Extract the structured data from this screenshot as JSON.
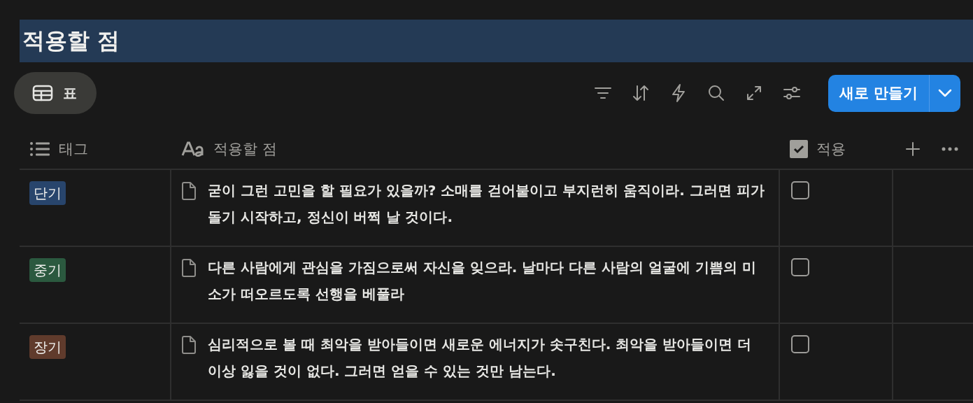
{
  "title": "적용할 점",
  "view_tab": {
    "label": "표",
    "selected": true
  },
  "new_button": {
    "label": "새로 만들기"
  },
  "columns": [
    {
      "kind": "select",
      "label": "태그"
    },
    {
      "kind": "title",
      "label": "적용할 점"
    },
    {
      "kind": "checkbox",
      "label": "적용"
    }
  ],
  "rows": [
    {
      "tag": {
        "label": "단기",
        "color": "#28456c"
      },
      "text": "굳이 그런 고민을 할 필요가 있을까? 소매를 걷어붙이고 부지런히 움직이라. 그러면 피가 돌기 시작하고, 정신이 버쩍 날 것이다.",
      "checked": false
    },
    {
      "tag": {
        "label": "중기",
        "color": "#2b593f"
      },
      "text": "다른 사람에게 관심을 가짐으로써 자신을 잊으라. 날마다 다른 사람의 얼굴에 기쁨의 미소가 떠오르도록 선행을 베풀라",
      "checked": false
    },
    {
      "tag": {
        "label": "장기",
        "color": "#603b2c"
      },
      "text": "심리적으로 볼 때 최악을 받아들이면 새로운 에너지가 솟구친다. 최악을 받아들이면 더 이상 잃을 것이 없다. 그러면 얻을 수 있는 것만 남는다.",
      "checked": false
    }
  ]
}
